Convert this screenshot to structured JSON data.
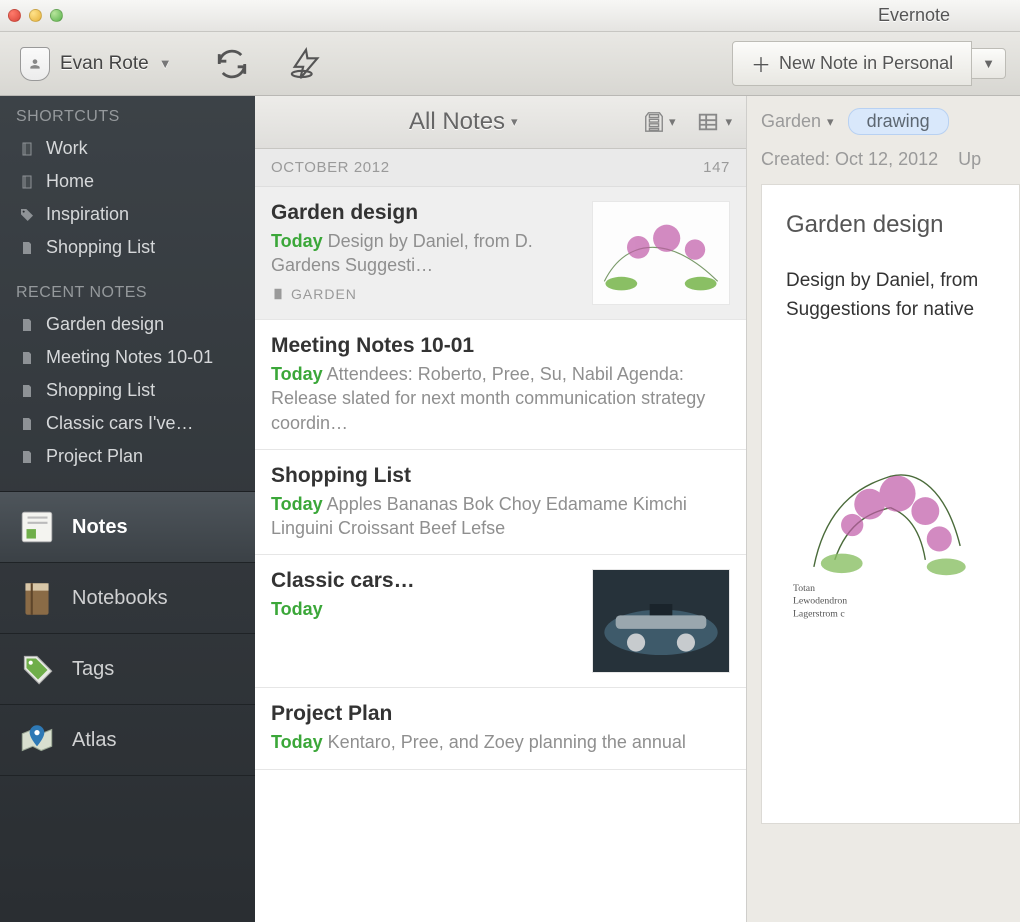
{
  "app": {
    "title": "Evernote"
  },
  "toolbar": {
    "user_name": "Evan Rote",
    "new_note_label": "New Note in Personal"
  },
  "sidebar": {
    "shortcuts_label": "SHORTCUTS",
    "shortcuts": [
      {
        "label": "Work",
        "icon": "notebook"
      },
      {
        "label": "Home",
        "icon": "notebook"
      },
      {
        "label": "Inspiration",
        "icon": "tag"
      },
      {
        "label": "Shopping List",
        "icon": "note"
      }
    ],
    "recent_label": "RECENT NOTES",
    "recent": [
      {
        "label": "Garden design"
      },
      {
        "label": "Meeting Notes 10-01"
      },
      {
        "label": "Shopping List"
      },
      {
        "label": "Classic cars I've…"
      },
      {
        "label": "Project Plan"
      }
    ],
    "sources": [
      {
        "label": "Notes",
        "active": true
      },
      {
        "label": "Notebooks",
        "active": false
      },
      {
        "label": "Tags",
        "active": false
      },
      {
        "label": "Atlas",
        "active": false
      }
    ]
  },
  "notelist": {
    "header_title": "All Notes",
    "group_label": "OCTOBER 2012",
    "group_count": "147",
    "rows": [
      {
        "title": "Garden design",
        "date": "Today",
        "snippet": "Design by Daniel, from D. Gardens Suggesti…",
        "tag": "GARDEN",
        "selected": true,
        "thumb": "garden"
      },
      {
        "title": "Meeting Notes 10-01",
        "date": "Today",
        "snippet": "Attendees: Roberto, Pree, Su, Nabil Agenda: Release slated for next month communication strategy coordin…"
      },
      {
        "title": "Shopping List",
        "date": "Today",
        "snippet": "Apples Bananas Bok Choy Edamame Kimchi Linguini Croissant Beef Lefse"
      },
      {
        "title": "Classic cars…",
        "date": "Today",
        "snippet": "",
        "thumb": "car"
      },
      {
        "title": "Project Plan",
        "date": "Today",
        "snippet": "Kentaro, Pree, and Zoey planning the annual"
      }
    ]
  },
  "detail": {
    "notebook": "Garden",
    "tag": "drawing",
    "created_label": "Created: Oct 12, 2012",
    "updated_label": "Up",
    "title": "Garden design",
    "body": "Design by Daniel, from\nSuggestions for native"
  }
}
